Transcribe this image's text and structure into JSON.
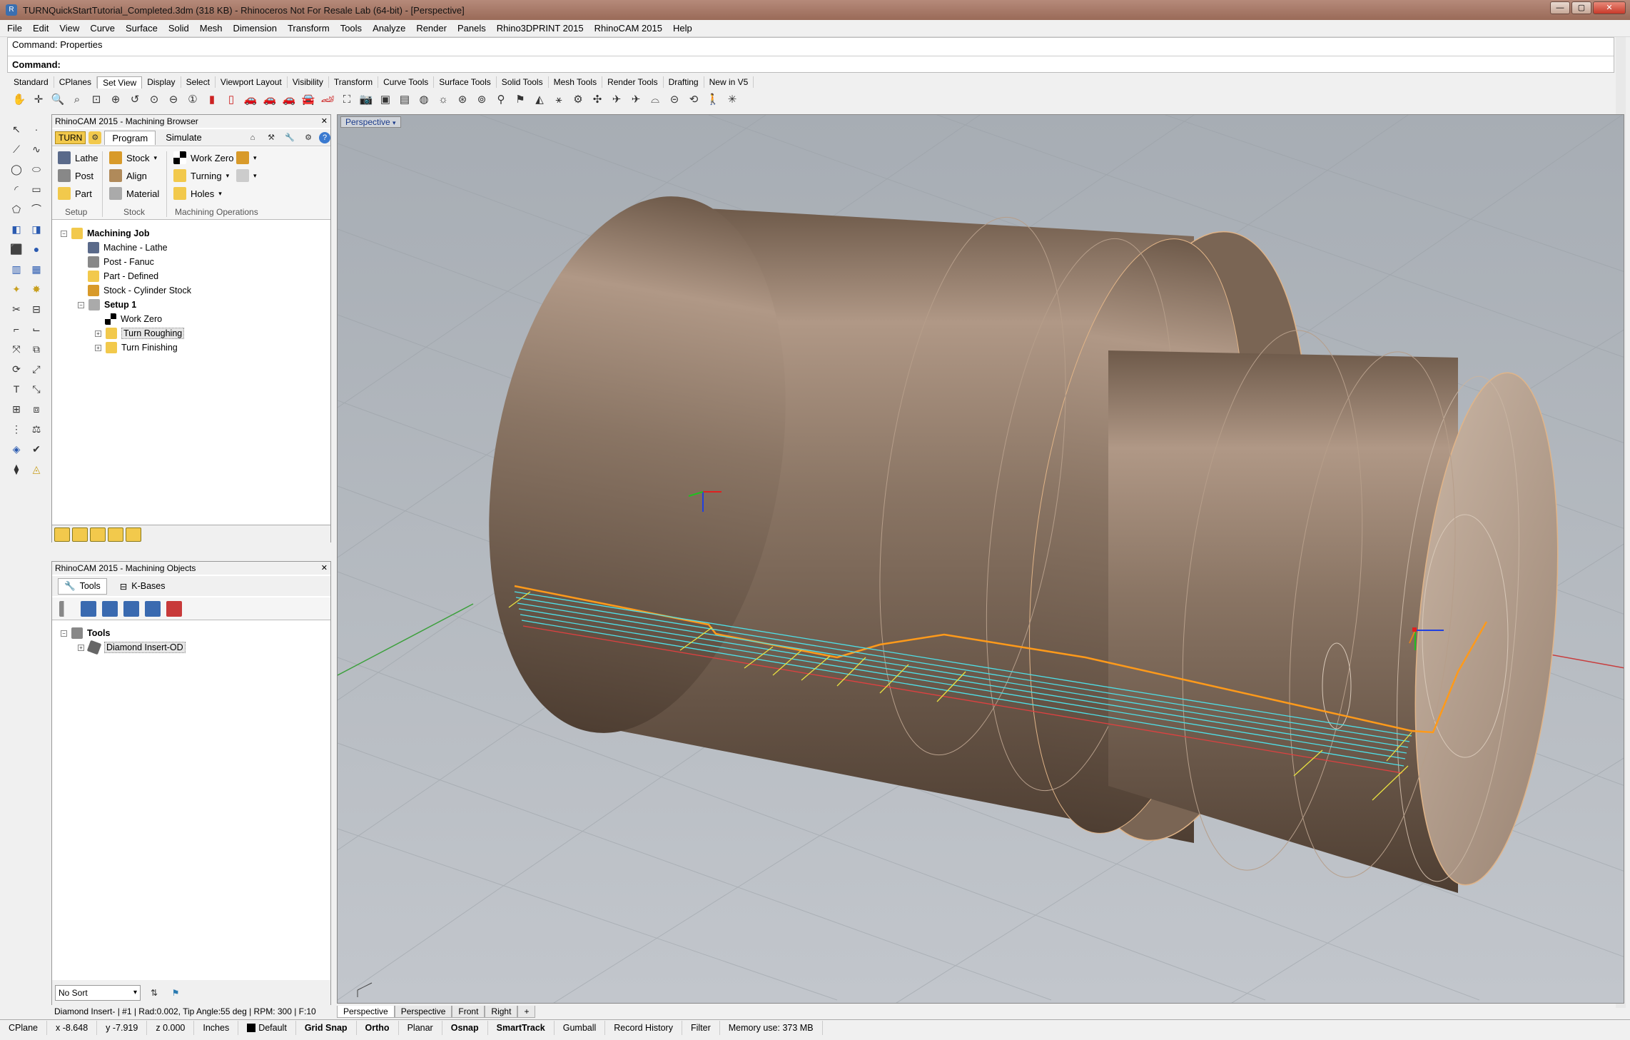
{
  "window": {
    "title": "TURNQuickStartTutorial_Completed.3dm (318 KB) - Rhinoceros Not For Resale Lab (64-bit) - [Perspective]"
  },
  "menu": [
    "File",
    "Edit",
    "View",
    "Curve",
    "Surface",
    "Solid",
    "Mesh",
    "Dimension",
    "Transform",
    "Tools",
    "Analyze",
    "Render",
    "Panels",
    "Rhino3DPRINT 2015",
    "RhinoCAM 2015",
    "Help"
  ],
  "command": {
    "history": "Command: Properties",
    "prompt": "Command:"
  },
  "toolbar_tabs": [
    "Standard",
    "CPlanes",
    "Set View",
    "Display",
    "Select",
    "Viewport Layout",
    "Visibility",
    "Transform",
    "Curve Tools",
    "Surface Tools",
    "Solid Tools",
    "Mesh Tools",
    "Render Tools",
    "Drafting",
    "New in V5"
  ],
  "browser": {
    "title": "RhinoCAM 2015 - Machining Browser",
    "turn": "TURN",
    "tabs": [
      "Program",
      "Simulate"
    ],
    "ribbon": {
      "setup": [
        "Lathe",
        "Post",
        "Part"
      ],
      "stock": [
        "Stock",
        "Align",
        "Material"
      ],
      "ops": [
        "Work Zero",
        "Turning",
        "Holes"
      ],
      "groups": [
        "Setup",
        "Stock",
        "Machining Operations"
      ]
    },
    "tree": {
      "job": "Machining Job",
      "machine": "Machine - Lathe",
      "post": "Post - Fanuc",
      "part": "Part - Defined",
      "stock": "Stock - Cylinder Stock",
      "setup": "Setup 1",
      "workzero": "Work Zero",
      "op1": "Turn Roughing",
      "op2": "Turn Finishing"
    }
  },
  "objects": {
    "title": "RhinoCAM 2015 - Machining Objects",
    "tabs": [
      "Tools",
      "K-Bases"
    ],
    "tree_root": "Tools",
    "tree_item": "Diamond Insert-OD",
    "sort": "No Sort",
    "info": "Diamond Insert- | #1 | Rad:0.002, Tip Angle:55 deg | RPM: 300 | F:10"
  },
  "viewport": {
    "label": "Perspective",
    "tabs": [
      "Perspective",
      "Perspective",
      "Front",
      "Right"
    ],
    "add": "+"
  },
  "status": {
    "cplane": "CPlane",
    "x": "x -8.648",
    "y": "y -7.919",
    "z": "z 0.000",
    "units": "Inches",
    "layer": "Default",
    "grid_snap": "Grid Snap",
    "ortho": "Ortho",
    "planar": "Planar",
    "osnap": "Osnap",
    "smarttrack": "SmartTrack",
    "gumball": "Gumball",
    "record_history": "Record History",
    "filter": "Filter",
    "memory": "Memory use: 373 MB"
  },
  "colors": {
    "part": "#8a7260",
    "toolpath_orange": "#ff9a1a",
    "toolpath_cyan": "#4ee0e8",
    "toolpath_yellow": "#e8e040",
    "axis_red": "#c83c3c",
    "axis_green": "#3ca03c"
  }
}
